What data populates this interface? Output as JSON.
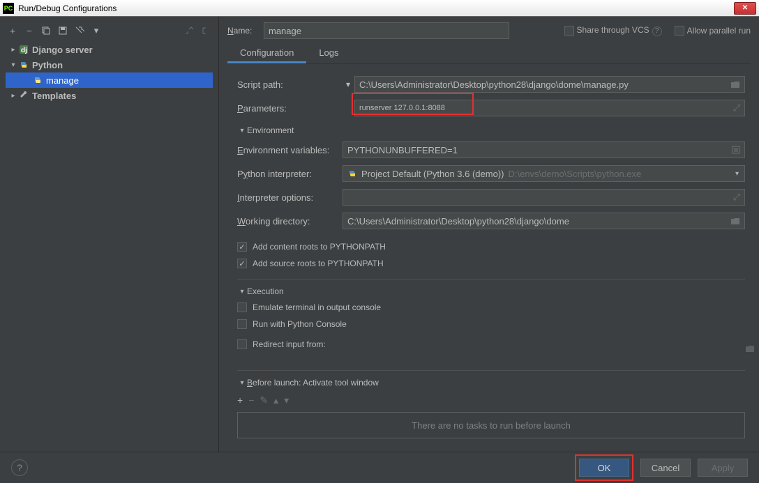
{
  "window": {
    "title": "Run/Debug Configurations"
  },
  "tree": {
    "items": [
      "Django server",
      "Python",
      "manage",
      "Templates"
    ]
  },
  "name": {
    "label": "Name:",
    "value": "manage"
  },
  "options": {
    "share": "Share through VCS",
    "parallel": "Allow parallel run"
  },
  "tabs": {
    "configuration": "Configuration",
    "logs": "Logs"
  },
  "form": {
    "script_path": {
      "label": "Script path:",
      "value": "C:\\Users\\Administrator\\Desktop\\python28\\django\\dome\\manage.py"
    },
    "parameters": {
      "label": "Parameters:",
      "value": "runserver 127.0.0.1:8088"
    },
    "environment_section": "Environment",
    "env_vars": {
      "label": "Environment variables:",
      "value": "PYTHONUNBUFFERED=1"
    },
    "interpreter": {
      "label": "Python interpreter:",
      "value": "Project Default (Python 3.6 (demo))",
      "path": "D:\\envs\\demo\\Scripts\\python.exe"
    },
    "interpreter_options": {
      "label": "Interpreter options:",
      "value": ""
    },
    "working_dir": {
      "label": "Working directory:",
      "value": "C:\\Users\\Administrator\\Desktop\\python28\\django\\dome"
    },
    "add_content_roots": "Add content roots to PYTHONPATH",
    "add_source_roots": "Add source roots to PYTHONPATH",
    "execution_section": "Execution",
    "emulate_terminal": "Emulate terminal in output console",
    "run_console": "Run with Python Console",
    "redirect_input": "Redirect input from:"
  },
  "before_launch": {
    "label": "Before launch: Activate tool window",
    "empty": "There are no tasks to run before launch"
  },
  "footer": {
    "ok": "OK",
    "cancel": "Cancel",
    "apply": "Apply"
  }
}
